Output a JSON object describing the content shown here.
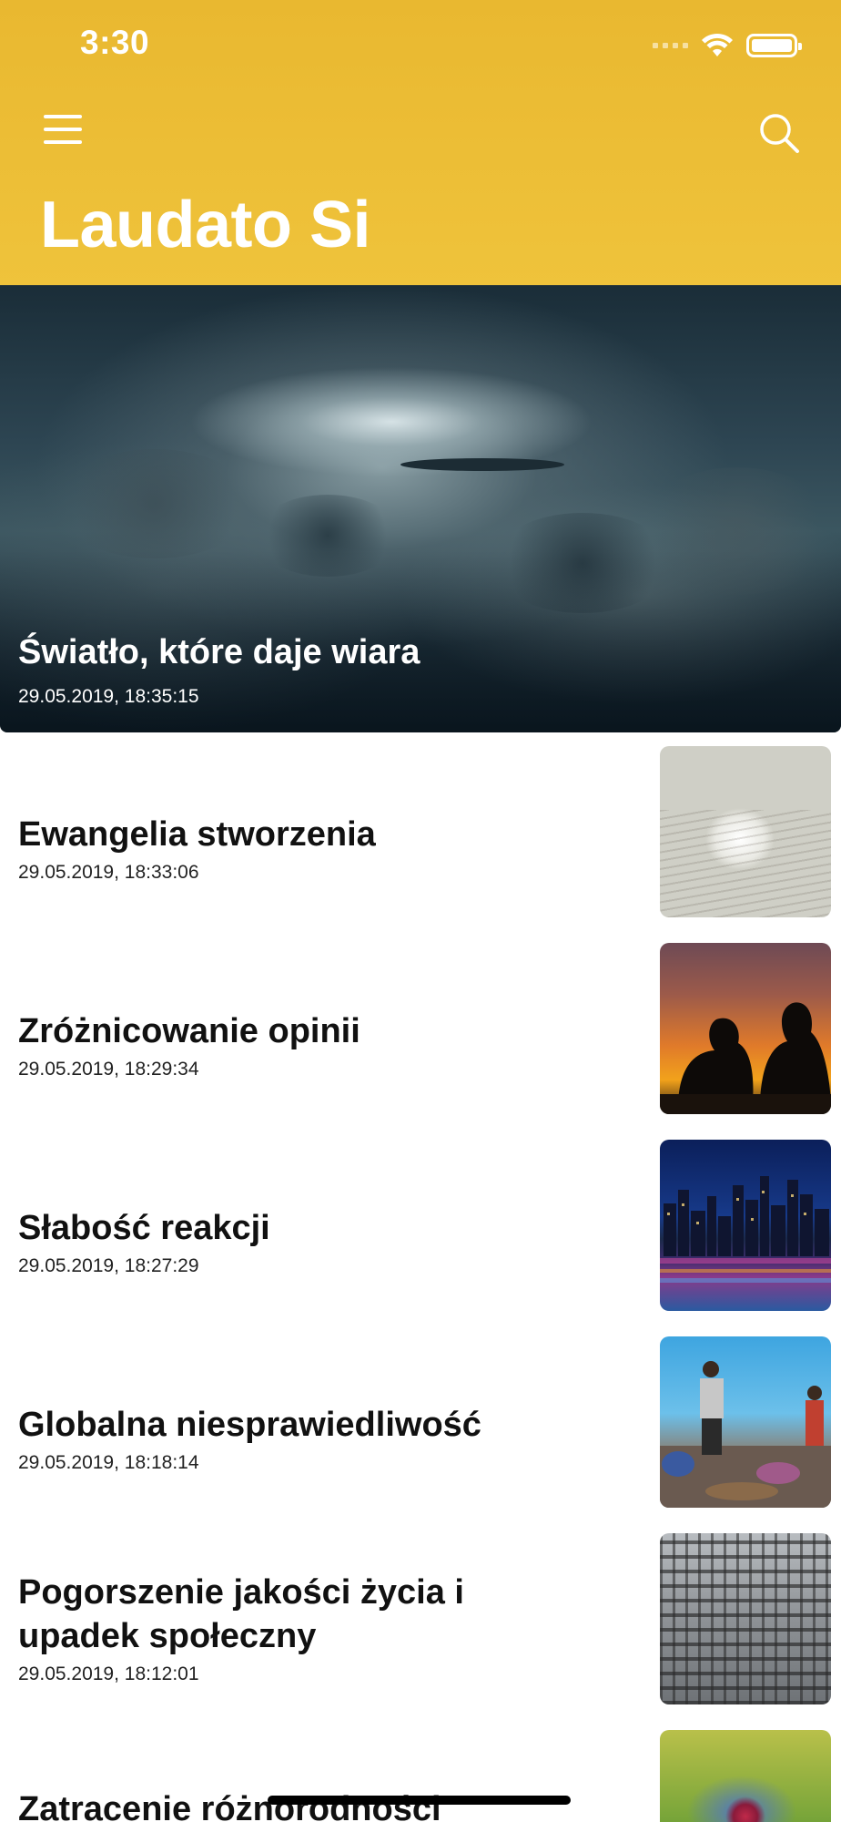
{
  "status_bar": {
    "time": "3:30",
    "icons": [
      "signal-icon",
      "wifi-icon",
      "battery-icon"
    ]
  },
  "header": {
    "title": "Laudato Si",
    "background_color": "#edbf36",
    "menu_icon": "hamburger-menu-icon",
    "search_icon": "search-icon"
  },
  "featured": {
    "title": "Światło, które daje wiara",
    "date": "29.05.2019, 18:35:15",
    "image": "dramatic-clouds-sky-photo"
  },
  "articles": [
    {
      "title": "Ewangelia stworzenia",
      "date": "29.05.2019, 18:33:06",
      "image": "book-with-plant-egg-photo"
    },
    {
      "title": "Zróżnicowanie opinii",
      "date": "29.05.2019, 18:29:34",
      "image": "sunset-silhouettes-photo"
    },
    {
      "title": "Słabość reakcji",
      "date": "29.05.2019, 18:27:29",
      "image": "city-skyline-night-photo"
    },
    {
      "title": "Globalna niesprawiedliwość",
      "date": "29.05.2019, 18:18:14",
      "image": "people-sorting-waste-photo"
    },
    {
      "title": "Pogorszenie jakości życia i upadek społeczny",
      "date": "29.05.2019, 18:12:01",
      "image": "apartment-block-facade-photo"
    },
    {
      "title": "Zatracenie różnorodności",
      "date": "",
      "image": "insect-on-flower-photo"
    }
  ]
}
